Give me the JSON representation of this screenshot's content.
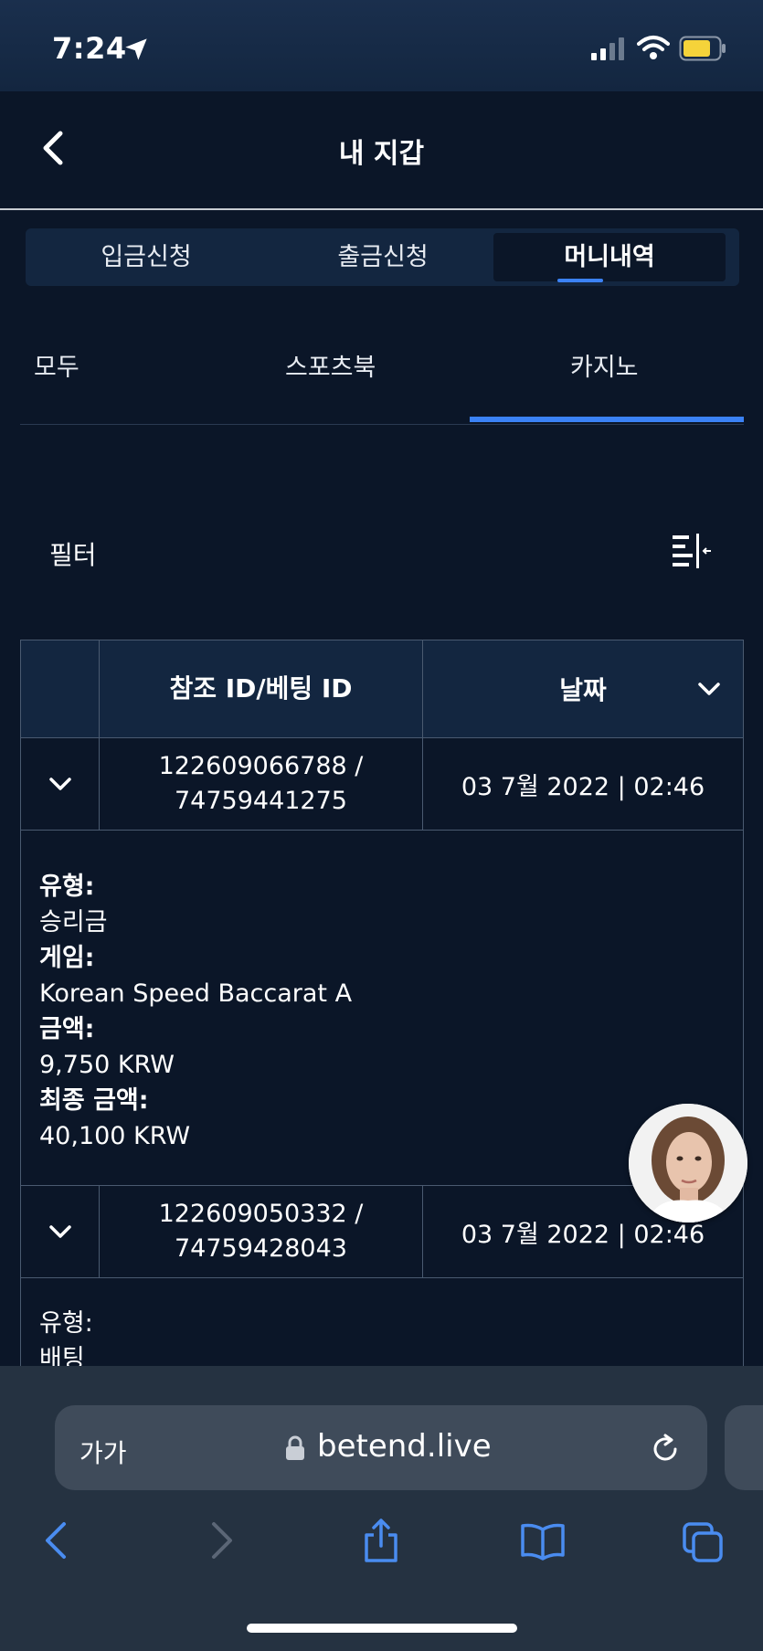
{
  "status": {
    "time": "7:24"
  },
  "header": {
    "title": "내 지갑"
  },
  "tabs": [
    {
      "label": "입금신청"
    },
    {
      "label": "출금신청"
    },
    {
      "label": "머니내역",
      "active": true
    }
  ],
  "subtabs": [
    {
      "label": "모두"
    },
    {
      "label": "스포츠북"
    },
    {
      "label": "카지노",
      "active": true
    }
  ],
  "filter": {
    "label": "필터"
  },
  "table": {
    "headers": {
      "ref": "참조 ID/베팅 ID",
      "date": "날짜"
    },
    "rows": [
      {
        "ref_line1": "122609066788 /",
        "ref_line2": "74759441275",
        "date": "03 7월 2022 | 02:46",
        "details": {
          "type_label": "유형:",
          "type_value": "승리금",
          "game_label": "게임:",
          "game_value": "Korean Speed Baccarat A",
          "amount_label": "금액:",
          "amount_value": "9,750 KRW",
          "final_label": "최종 금액:",
          "final_value": "40,100 KRW"
        }
      },
      {
        "ref_line1": "122609050332 /",
        "ref_line2": "74759428043",
        "date": "03 7월 2022 | 02:46",
        "details": {
          "type_label": "유형:",
          "type_value": "배팅"
        }
      }
    ]
  },
  "browser": {
    "text_size": "가가",
    "domain": "betend.live"
  },
  "colors": {
    "background": "#0b1628",
    "accent": "#3b82f6",
    "panel": "#132640"
  }
}
